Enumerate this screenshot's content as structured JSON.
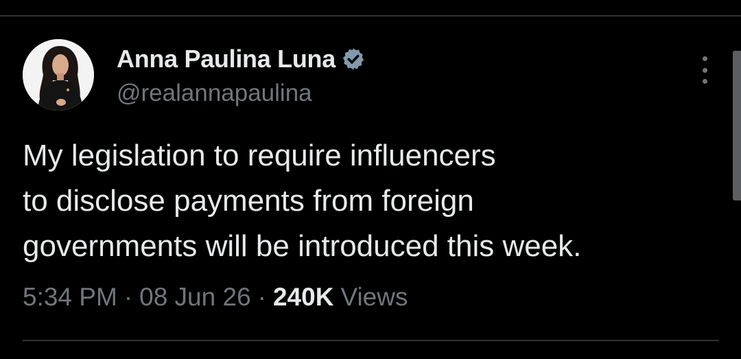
{
  "tweet": {
    "author": {
      "name": "Anna Paulina Luna",
      "handle": "@realannapaulina",
      "verified": true,
      "avatar_icon": "profile-photo"
    },
    "text_lines": [
      "My legislation to require influencers",
      "to disclose payments from foreign",
      "governments will be introduced this week."
    ],
    "meta": {
      "time": "5:34 PM",
      "separator": "·",
      "date": "08 Jun 26",
      "views_count": "240K",
      "views_label": "Views"
    },
    "more_icon": "more-vertical-icon"
  },
  "colors": {
    "background": "#000000",
    "primary_text": "#e7e9ea",
    "secondary_text": "#71767b",
    "divider": "#2f3336",
    "verified_badge": "#829aab"
  }
}
